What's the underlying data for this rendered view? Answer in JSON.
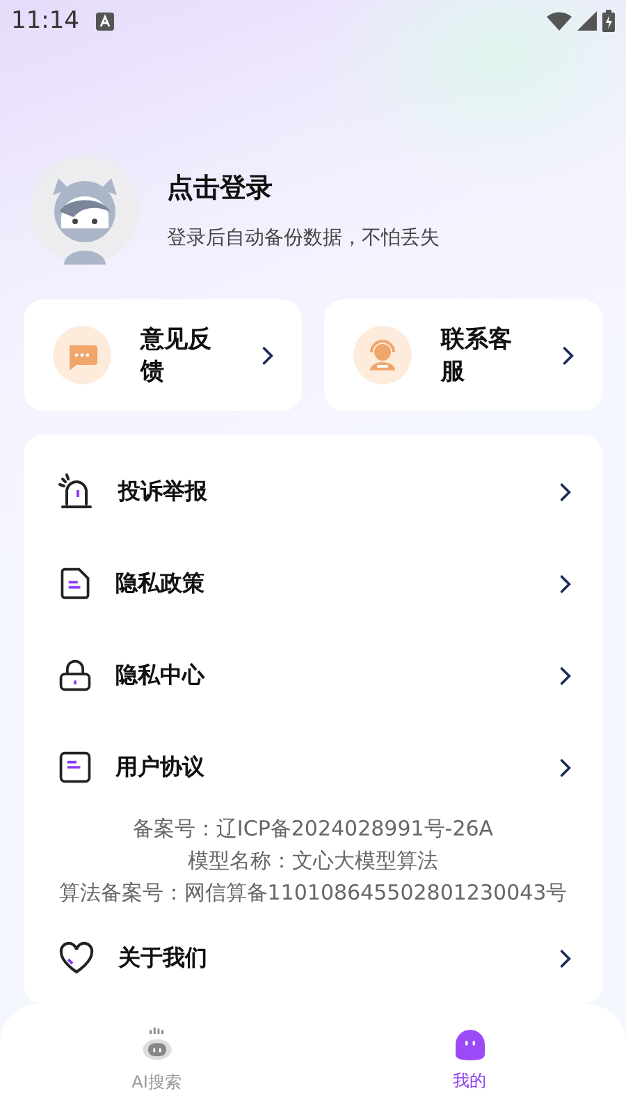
{
  "status_bar": {
    "time": "11:14"
  },
  "profile": {
    "title": "点击登录",
    "subtitle": "登录后自动备份数据，不怕丢失"
  },
  "quick_actions": [
    {
      "kind": "feedback",
      "label": "意见反馈"
    },
    {
      "kind": "support",
      "label": "联系客服"
    }
  ],
  "menu": [
    {
      "kind": "report",
      "label": "投诉举报"
    },
    {
      "kind": "policy",
      "label": "隐私政策"
    },
    {
      "kind": "privacy",
      "label": "隐私中心"
    },
    {
      "kind": "agreement",
      "label": "用户协议"
    },
    {
      "kind": "about",
      "label": "关于我们"
    }
  ],
  "filing": [
    "备案号：辽ICP备2024028991号-26A",
    "模型名称：文心大模型算法",
    "算法备案号：网信算备110108645502801230043号"
  ],
  "bottom_nav": [
    {
      "kind": "ai",
      "label": "AI搜索",
      "selected": false
    },
    {
      "kind": "me",
      "label": "我的",
      "selected": true
    }
  ]
}
